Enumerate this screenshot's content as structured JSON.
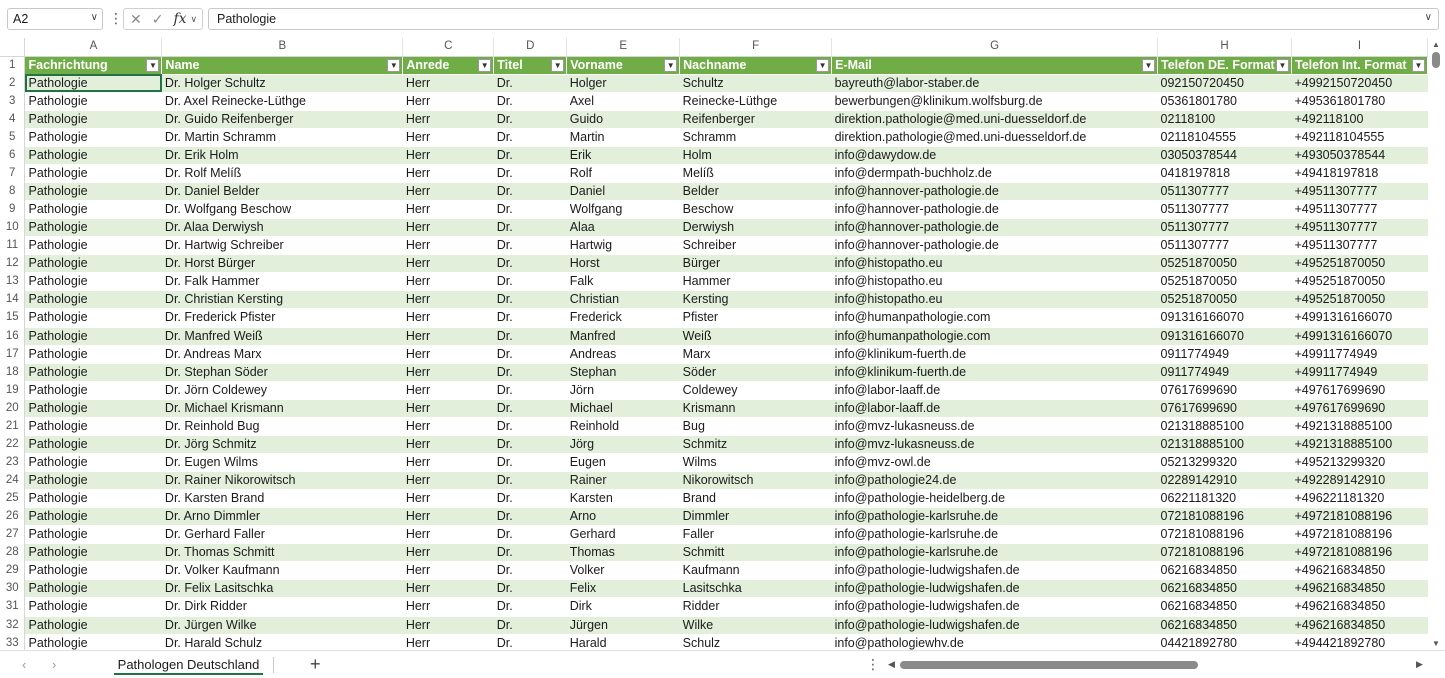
{
  "formula_bar": {
    "name_box": "A2",
    "value": "Pathologie"
  },
  "columns": [
    "A",
    "B",
    "C",
    "D",
    "E",
    "F",
    "G",
    "H",
    "I"
  ],
  "headers": [
    "Fachrichtung",
    "Name",
    "Anrede",
    "Titel",
    "Vorname",
    "Nachname",
    "E-Mail",
    "Telefon DE. Format",
    "Telefon Int. Format"
  ],
  "rows": [
    [
      "Pathologie",
      "Dr. Holger Schultz",
      "Herr",
      "Dr.",
      "Holger",
      "Schultz",
      "bayreuth@labor-staber.de",
      "092150720450",
      "+4992150720450"
    ],
    [
      "Pathologie",
      "Dr. Axel Reinecke-Lüthge",
      "Herr",
      "Dr.",
      "Axel",
      "Reinecke-Lüthge",
      "bewerbungen@klinikum.wolfsburg.de",
      "05361801780",
      "+495361801780"
    ],
    [
      "Pathologie",
      "Dr. Guido Reifenberger",
      "Herr",
      "Dr.",
      "Guido",
      "Reifenberger",
      "direktion.pathologie@med.uni-duesseldorf.de",
      "02118100",
      "+492118100"
    ],
    [
      "Pathologie",
      "Dr. Martin Schramm",
      "Herr",
      "Dr.",
      "Martin",
      "Schramm",
      "direktion.pathologie@med.uni-duesseldorf.de",
      "02118104555",
      "+492118104555"
    ],
    [
      "Pathologie",
      "Dr. Erik Holm",
      "Herr",
      "Dr.",
      "Erik",
      "Holm",
      "info@dawydow.de",
      "03050378544",
      "+493050378544"
    ],
    [
      "Pathologie",
      "Dr. Rolf Melíß",
      "Herr",
      "Dr.",
      "Rolf",
      "Melíß",
      "info@dermpath-buchholz.de",
      "0418197818",
      "+49418197818"
    ],
    [
      "Pathologie",
      "Dr. Daniel Belder",
      "Herr",
      "Dr.",
      "Daniel",
      "Belder",
      "info@hannover-pathologie.de",
      "0511307777",
      "+49511307777"
    ],
    [
      "Pathologie",
      "Dr. Wolfgang Beschow",
      "Herr",
      "Dr.",
      "Wolfgang",
      "Beschow",
      "info@hannover-pathologie.de",
      "0511307777",
      "+49511307777"
    ],
    [
      "Pathologie",
      "Dr. Alaa Derwiysh",
      "Herr",
      "Dr.",
      "Alaa",
      "Derwiysh",
      "info@hannover-pathologie.de",
      "0511307777",
      "+49511307777"
    ],
    [
      "Pathologie",
      "Dr. Hartwig Schreiber",
      "Herr",
      "Dr.",
      "Hartwig",
      "Schreiber",
      "info@hannover-pathologie.de",
      "0511307777",
      "+49511307777"
    ],
    [
      "Pathologie",
      "Dr. Horst Bürger",
      "Herr",
      "Dr.",
      "Horst",
      "Bürger",
      "info@histopatho.eu",
      "05251870050",
      "+495251870050"
    ],
    [
      "Pathologie",
      "Dr. Falk Hammer",
      "Herr",
      "Dr.",
      "Falk",
      "Hammer",
      "info@histopatho.eu",
      "05251870050",
      "+495251870050"
    ],
    [
      "Pathologie",
      "Dr. Christian Kersting",
      "Herr",
      "Dr.",
      "Christian",
      "Kersting",
      "info@histopatho.eu",
      "05251870050",
      "+495251870050"
    ],
    [
      "Pathologie",
      "Dr. Frederick Pfister",
      "Herr",
      "Dr.",
      "Frederick",
      "Pfister",
      "info@humanpathologie.com",
      "091316166070",
      "+4991316166070"
    ],
    [
      "Pathologie",
      "Dr. Manfred Weiß",
      "Herr",
      "Dr.",
      "Manfred",
      "Weiß",
      "info@humanpathologie.com",
      "091316166070",
      "+4991316166070"
    ],
    [
      "Pathologie",
      "Dr. Andreas Marx",
      "Herr",
      "Dr.",
      "Andreas",
      "Marx",
      "info@klinikum-fuerth.de",
      "0911774949",
      "+49911774949"
    ],
    [
      "Pathologie",
      "Dr. Stephan Söder",
      "Herr",
      "Dr.",
      "Stephan",
      "Söder",
      "info@klinikum-fuerth.de",
      "0911774949",
      "+49911774949"
    ],
    [
      "Pathologie",
      "Dr. Jörn Coldewey",
      "Herr",
      "Dr.",
      "Jörn",
      "Coldewey",
      "info@labor-laaff.de",
      "07617699690",
      "+497617699690"
    ],
    [
      "Pathologie",
      "Dr. Michael Krismann",
      "Herr",
      "Dr.",
      "Michael",
      "Krismann",
      "info@labor-laaff.de",
      "07617699690",
      "+497617699690"
    ],
    [
      "Pathologie",
      "Dr. Reinhold Bug",
      "Herr",
      "Dr.",
      "Reinhold",
      "Bug",
      "info@mvz-lukasneuss.de",
      "021318885100",
      "+4921318885100"
    ],
    [
      "Pathologie",
      "Dr. Jörg Schmitz",
      "Herr",
      "Dr.",
      "Jörg",
      "Schmitz",
      "info@mvz-lukasneuss.de",
      "021318885100",
      "+4921318885100"
    ],
    [
      "Pathologie",
      "Dr. Eugen Wilms",
      "Herr",
      "Dr.",
      "Eugen",
      "Wilms",
      "info@mvz-owl.de",
      "05213299320",
      "+495213299320"
    ],
    [
      "Pathologie",
      "Dr. Rainer Nikorowitsch",
      "Herr",
      "Dr.",
      "Rainer",
      "Nikorowitsch",
      "info@pathologie24.de",
      "02289142910",
      "+492289142910"
    ],
    [
      "Pathologie",
      "Dr. Karsten Brand",
      "Herr",
      "Dr.",
      "Karsten",
      "Brand",
      "info@pathologie-heidelberg.de",
      "06221181320",
      "+496221181320"
    ],
    [
      "Pathologie",
      "Dr. Arno Dimmler",
      "Herr",
      "Dr.",
      "Arno",
      "Dimmler",
      "info@pathologie-karlsruhe.de",
      "072181088196",
      "+4972181088196"
    ],
    [
      "Pathologie",
      "Dr. Gerhard Faller",
      "Herr",
      "Dr.",
      "Gerhard",
      "Faller",
      "info@pathologie-karlsruhe.de",
      "072181088196",
      "+4972181088196"
    ],
    [
      "Pathologie",
      "Dr. Thomas Schmitt",
      "Herr",
      "Dr.",
      "Thomas",
      "Schmitt",
      "info@pathologie-karlsruhe.de",
      "072181088196",
      "+4972181088196"
    ],
    [
      "Pathologie",
      "Dr. Volker Kaufmann",
      "Herr",
      "Dr.",
      "Volker",
      "Kaufmann",
      "info@pathologie-ludwigshafen.de",
      "06216834850",
      "+496216834850"
    ],
    [
      "Pathologie",
      "Dr. Felix Lasitschka",
      "Herr",
      "Dr.",
      "Felix",
      "Lasitschka",
      "info@pathologie-ludwigshafen.de",
      "06216834850",
      "+496216834850"
    ],
    [
      "Pathologie",
      "Dr. Dirk Ridder",
      "Herr",
      "Dr.",
      "Dirk",
      "Ridder",
      "info@pathologie-ludwigshafen.de",
      "06216834850",
      "+496216834850"
    ],
    [
      "Pathologie",
      "Dr. Jürgen Wilke",
      "Herr",
      "Dr.",
      "Jürgen",
      "Wilke",
      "info@pathologie-ludwigshafen.de",
      "06216834850",
      "+496216834850"
    ],
    [
      "Pathologie",
      "Dr. Harald Schulz",
      "Herr",
      "Dr.",
      "Harald",
      "Schulz",
      "info@pathologiewhv.de",
      "04421892780",
      "+494421892780"
    ]
  ],
  "sheet_tab": "Pathologen Deutschland",
  "colors": {
    "header_green": "#70ad47",
    "band_green": "#e2efda",
    "accent": "#217346"
  }
}
